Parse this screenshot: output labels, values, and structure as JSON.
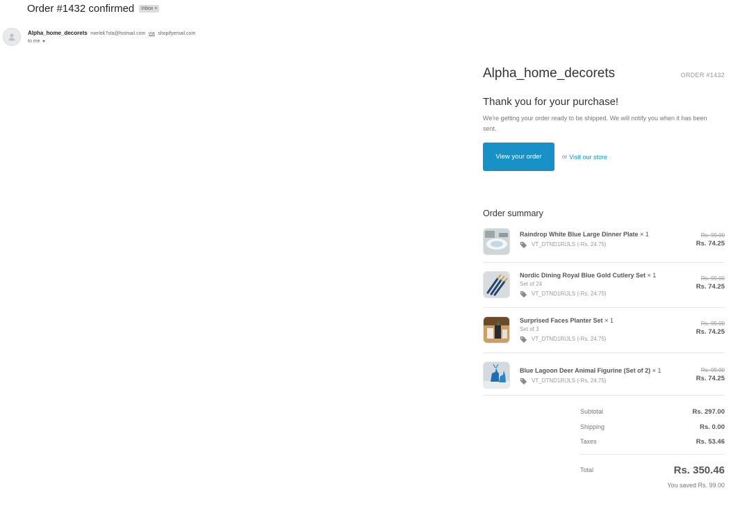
{
  "subject": {
    "title": "Order #1432 confirmed",
    "badge": "Inbox ×"
  },
  "sender": {
    "name": "Alpha_home_decorets",
    "email": "merlek7sta@hotmail.com",
    "via": "via",
    "domain": "shopifyemail.com",
    "to": "to me"
  },
  "email": {
    "store_name": "Alpha_home_decorets",
    "order_number": "ORDER #1432",
    "thanks": "Thank you for your purchase!",
    "notice": "We're getting your order ready to be shipped. We will notify you when it has been sent.",
    "view_order_label": "View your order",
    "or_text": "or",
    "visit_store_label": "Visit our store",
    "summary_title": "Order summary",
    "items": [
      {
        "title": "Raindrop White Blue Large Dinner Plate",
        "qty": "× 1",
        "variant": "",
        "discount": "VT_DTND1RIJLS (-Rs. 24.75)",
        "original_price": "Rs. 99.00",
        "price": "Rs. 74.25",
        "image": "dinner-plate"
      },
      {
        "title": "Nordic Dining Royal Blue Gold Cutlery Set",
        "qty": "× 1",
        "variant": "Set of 24",
        "discount": "VT_DTND1RIJLS (-Rs. 24.75)",
        "original_price": "Rs. 99.00",
        "price": "Rs. 74.25",
        "image": "cutlery-set"
      },
      {
        "title": "Surprised Faces Planter Set",
        "qty": "× 1",
        "variant": "Set of 3",
        "discount": "VT_DTND1RIJLS (-Rs. 24.75)",
        "original_price": "Rs. 99.00",
        "price": "Rs. 74.25",
        "image": "planter-set"
      },
      {
        "title": "Blue Lagoon Deer Animal Figurine (Set of 2)",
        "qty": "× 1",
        "variant": "",
        "discount": "VT_DTND1RIJLS (-Rs. 24.75)",
        "original_price": "Rs. 99.00",
        "price": "Rs. 74.25",
        "image": "deer-figurine"
      }
    ],
    "totals": {
      "subtotal_label": "Subtotal",
      "subtotal": "Rs. 297.00",
      "shipping_label": "Shipping",
      "shipping": "Rs. 0.00",
      "taxes_label": "Taxes",
      "taxes": "Rs. 53.46",
      "total_label": "Total",
      "total": "Rs. 350.46",
      "savings": "You saved Rs. 99.00"
    }
  },
  "colors": {
    "accent": "#1990c6",
    "text": "#333333",
    "muted": "#777777"
  }
}
